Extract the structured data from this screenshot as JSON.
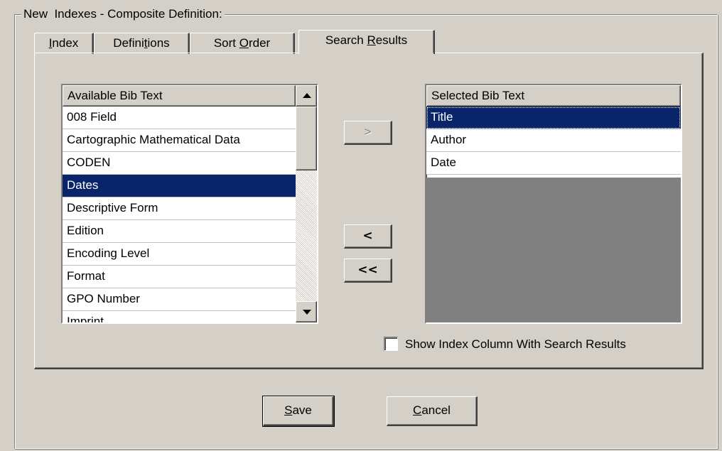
{
  "group_title": "New  Indexes - Composite Definition:",
  "tabs": [
    {
      "pre": "",
      "key": "I",
      "post": "ndex",
      "active": false
    },
    {
      "pre": "Defini",
      "key": "t",
      "post": "ions",
      "active": false
    },
    {
      "pre": "Sort ",
      "key": "O",
      "post": "rder",
      "active": false
    },
    {
      "pre": "Search ",
      "key": "R",
      "post": "esults",
      "active": true
    }
  ],
  "available": {
    "header": "Available Bib Text",
    "items": [
      "008 Field",
      "Cartographic Mathematical Data",
      "CODEN",
      "Dates",
      "Descriptive Form",
      "Edition",
      "Encoding Level",
      "Format",
      "GPO Number",
      "Imprint"
    ],
    "selected_index": 3
  },
  "selected": {
    "header": "Selected Bib Text",
    "items": [
      "Title",
      "Author",
      "Date"
    ],
    "selected_index": 0
  },
  "move_buttons": {
    "add": ">",
    "remove": "<",
    "remove_all": "<<"
  },
  "show_index_column": {
    "label": "Show Index Column With Search Results",
    "checked": false
  },
  "footer": {
    "save_key": "S",
    "save_rest": "ave",
    "cancel_key": "C",
    "cancel_rest": "ancel"
  }
}
